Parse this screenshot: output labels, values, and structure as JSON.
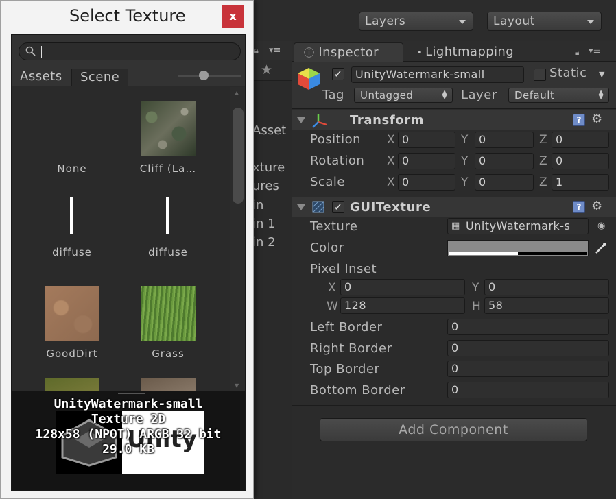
{
  "topbar": {
    "layers_label": "Layers",
    "layout_label": "Layout"
  },
  "midpanel": {
    "items": [
      "Asset",
      "xture",
      "ures",
      "in",
      "in 1",
      "in 2"
    ]
  },
  "inspector": {
    "tabs": [
      {
        "label": "Inspector",
        "icon": "info-icon"
      },
      {
        "label": "Lightmapping",
        "icon": "bulb-icon"
      }
    ],
    "gameobject": {
      "active": true,
      "name": "UnityWatermark-small",
      "static_label": "Static",
      "tag_label": "Tag",
      "tag_value": "Untagged",
      "layer_label": "Layer",
      "layer_value": "Default"
    },
    "transform": {
      "title": "Transform",
      "rows": [
        {
          "label": "Position",
          "x": "0",
          "y": "0",
          "z": "0"
        },
        {
          "label": "Rotation",
          "x": "0",
          "y": "0",
          "z": "0"
        },
        {
          "label": "Scale",
          "x": "0",
          "y": "0",
          "z": "1"
        }
      ],
      "axis": [
        "X",
        "Y",
        "Z"
      ]
    },
    "guitexture": {
      "title": "GUITexture",
      "enabled": true,
      "texture_label": "Texture",
      "texture_value": "UnityWatermark-s",
      "color_label": "Color",
      "pixel_inset_label": "Pixel Inset",
      "inset": {
        "x_label": "X",
        "x": "0",
        "y_label": "Y",
        "y": "0",
        "w_label": "W",
        "w": "128",
        "h_label": "H",
        "h": "58"
      },
      "borders": [
        {
          "label": "Left Border",
          "value": "0"
        },
        {
          "label": "Right Border",
          "value": "0"
        },
        {
          "label": "Top Border",
          "value": "0"
        },
        {
          "label": "Bottom Border",
          "value": "0"
        }
      ]
    },
    "add_component_label": "Add Component",
    "help_label": "?"
  },
  "select_texture": {
    "title": "Select Texture",
    "close_label": "x",
    "search_value": "",
    "tabs": [
      "Assets",
      "Scene"
    ],
    "active_tab": "Scene",
    "items": [
      {
        "name": "None",
        "icon": "none"
      },
      {
        "name": "Cliff (La…",
        "icon": "cliff-texture"
      },
      {
        "name": "diffuse",
        "icon": "line-texture"
      },
      {
        "name": "diffuse",
        "icon": "line-texture"
      },
      {
        "name": "GoodDirt",
        "icon": "dirt-texture"
      },
      {
        "name": "Grass",
        "icon": "grass-texture"
      },
      {
        "name": "",
        "icon": "grass-dirt-texture"
      },
      {
        "name": "",
        "icon": "gravel-texture"
      }
    ],
    "preview": {
      "name": "UnityWatermark-small",
      "type": "Texture 2D",
      "info": "128x58 (NPOT) ARGB 32 bit",
      "size": "29.0 KB",
      "logo_text": "Unity"
    }
  },
  "colors": {
    "close_red": "#c8333a",
    "help_blue": "#6f8cc8"
  }
}
